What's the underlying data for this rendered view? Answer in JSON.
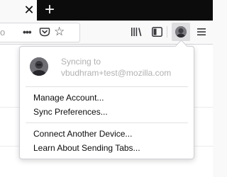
{
  "tabstrip": {
    "close_glyph": "✕",
    "new_tab_glyph": "+"
  },
  "navbar": {
    "url_fragment": "o",
    "page_actions_glyph": "•••",
    "bookmark_glyph": "☆",
    "icons": [
      "close-icon",
      "plus-icon",
      "page-actions-icon",
      "pocket-icon",
      "bookmark-star-icon",
      "library-icon",
      "sidebar-icon",
      "account-avatar-icon",
      "hamburger-menu-icon"
    ]
  },
  "account_panel": {
    "sync_status": "Syncing to",
    "email": "vbudhram+test@mozilla.com",
    "items": [
      {
        "label": "Manage Account..."
      },
      {
        "label": "Sync Preferences..."
      },
      {
        "label": "Connect Another Device..."
      },
      {
        "label": "Learn About Sending Tabs..."
      }
    ]
  },
  "colors": {
    "tabstrip_bg": "#0c0c0d",
    "toolbar_bg": "#f9f9fa",
    "panel_bg": "#ffffff",
    "muted_text": "#b1b1b3",
    "primary_text": "#0c0c0d"
  }
}
